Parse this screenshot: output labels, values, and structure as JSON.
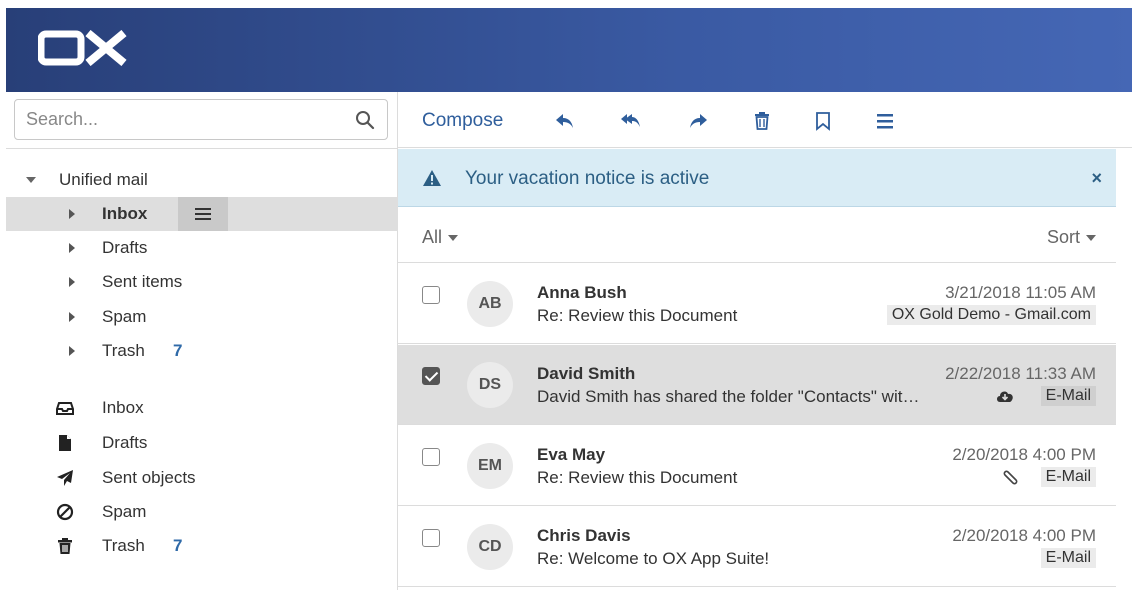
{
  "header": {
    "logo_text": "OX"
  },
  "search": {
    "placeholder": "Search..."
  },
  "sidebar": {
    "unified": {
      "label": "Unified mail",
      "items": [
        {
          "label": "Inbox",
          "count": ""
        },
        {
          "label": "Drafts",
          "count": ""
        },
        {
          "label": "Sent items",
          "count": ""
        },
        {
          "label": "Spam",
          "count": ""
        },
        {
          "label": "Trash",
          "count": "7"
        }
      ]
    },
    "folders": [
      {
        "label": "Inbox",
        "icon": "inbox-icon",
        "count": ""
      },
      {
        "label": "Drafts",
        "icon": "document-icon",
        "count": ""
      },
      {
        "label": "Sent objects",
        "icon": "paper-plane-icon",
        "count": ""
      },
      {
        "label": "Spam",
        "icon": "ban-icon",
        "count": ""
      },
      {
        "label": "Trash",
        "icon": "trash-icon",
        "count": "7"
      }
    ]
  },
  "toolbar": {
    "compose_label": "Compose",
    "icons": [
      "reply-icon",
      "reply-all-icon",
      "forward-icon",
      "delete-icon",
      "bookmark-icon",
      "more-menu-icon"
    ]
  },
  "banner": {
    "text": "Your vacation notice is active",
    "close": "×"
  },
  "filter": {
    "all_label": "All",
    "sort_label": "Sort"
  },
  "messages": [
    {
      "initials": "AB",
      "from": "Anna Bush",
      "subject": "Re: Review this Document",
      "date": "3/21/2018 11:05 AM",
      "folder": "OX Gold Demo - Gmail.com",
      "checked": false,
      "icon": ""
    },
    {
      "initials": "DS",
      "from": "David Smith",
      "subject": "David Smith has shared the folder \"Contacts\" wit…",
      "date": "2/22/2018 11:33 AM",
      "folder": "E-Mail",
      "checked": true,
      "icon": "cloud-download-icon"
    },
    {
      "initials": "EM",
      "from": "Eva May",
      "subject": "Re: Review this Document",
      "date": "2/20/2018 4:00 PM",
      "folder": "E-Mail",
      "checked": false,
      "icon": "paperclip-icon"
    },
    {
      "initials": "CD",
      "from": "Chris Davis",
      "subject": "Re: Welcome to OX App Suite!",
      "date": "2/20/2018 4:00 PM",
      "folder": "E-Mail",
      "checked": false,
      "icon": ""
    }
  ],
  "colors": {
    "header": "#3a5aa3",
    "accent": "#2f5e9c",
    "banner": "#d9ecf5",
    "selected": "#dedede"
  }
}
